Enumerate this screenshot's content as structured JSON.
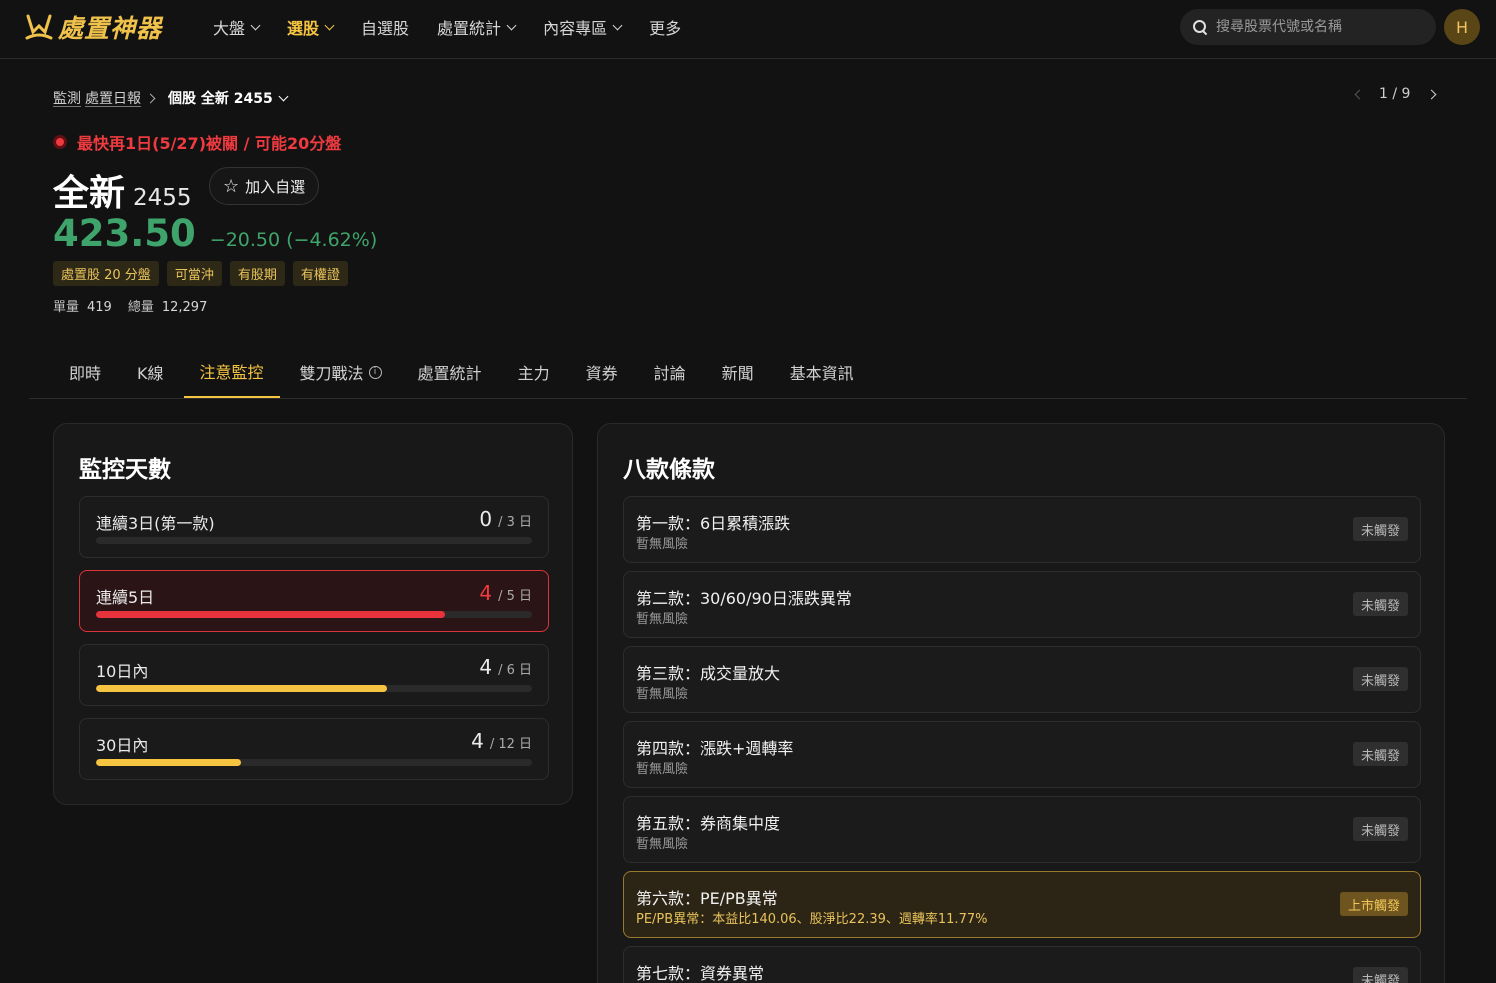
{
  "app": {
    "logo_text": "處置神器",
    "avatar_initial": "H"
  },
  "nav": {
    "items": [
      {
        "label": "大盤",
        "dropdown": true,
        "active": false
      },
      {
        "label": "選股",
        "dropdown": true,
        "active": true
      },
      {
        "label": "自選股",
        "dropdown": false,
        "active": false
      },
      {
        "label": "處置統計",
        "dropdown": true,
        "active": false
      },
      {
        "label": "內容專區",
        "dropdown": true,
        "active": false
      },
      {
        "label": "更多",
        "dropdown": false,
        "active": false
      }
    ],
    "search_placeholder": "搜尋股票代號或名稱"
  },
  "breadcrumb": {
    "link1": "監測",
    "link2": "處置日報",
    "current": "個股 全新 2455"
  },
  "pager": {
    "text": "1 / 9"
  },
  "alert": {
    "text": "最快再1日(5/27)被關 / 可能20分盤"
  },
  "stock": {
    "name": "全新",
    "code": "2455",
    "watch_label": "加入自選",
    "price": "423.50",
    "change": "−20.50 (−4.62%)",
    "tags": [
      "處置股 20 分盤",
      "可當沖",
      "有股期",
      "有權證"
    ],
    "single_volume_label": "單量",
    "single_volume": "419",
    "total_volume_label": "總量",
    "total_volume": "12,297"
  },
  "tabs": [
    {
      "label": "即時",
      "active": false
    },
    {
      "label": "K線",
      "active": false
    },
    {
      "label": "注意監控",
      "active": true
    },
    {
      "label": "雙刀戰法",
      "active": false,
      "info": true
    },
    {
      "label": "處置統計",
      "active": false
    },
    {
      "label": "主力",
      "active": false
    },
    {
      "label": "資券",
      "active": false
    },
    {
      "label": "討論",
      "active": false
    },
    {
      "label": "新聞",
      "active": false
    },
    {
      "label": "基本資訊",
      "active": false
    }
  ],
  "monitor": {
    "title": "監控天數",
    "items": [
      {
        "label": "連續3日(第一款)",
        "value": "0",
        "total": "/ 3 日",
        "progress": 0.0,
        "color": "#f5c542",
        "alert": false
      },
      {
        "label": "連續5日",
        "value": "4",
        "total": "/ 5 日",
        "progress": 0.8,
        "color": "#e8323c",
        "alert": true
      },
      {
        "label": "10日內",
        "value": "4",
        "total": "/ 6 日",
        "progress": 0.6667,
        "color": "#f5c542",
        "alert": false
      },
      {
        "label": "30日內",
        "value": "4",
        "total": "/ 12 日",
        "progress": 0.3333,
        "color": "#f5c542",
        "alert": false
      }
    ]
  },
  "rules": {
    "title": "八款條款",
    "items": [
      {
        "title": "第一款：6日累積漲跌",
        "sub": "暫無風險",
        "badge": "未觸發",
        "hit": false
      },
      {
        "title": "第二款：30/60/90日漲跌異常",
        "sub": "暫無風險",
        "badge": "未觸發",
        "hit": false
      },
      {
        "title": "第三款：成交量放大",
        "sub": "暫無風險",
        "badge": "未觸發",
        "hit": false
      },
      {
        "title": "第四款：漲跌+週轉率",
        "sub": "暫無風險",
        "badge": "未觸發",
        "hit": false
      },
      {
        "title": "第五款：券商集中度",
        "sub": "暫無風險",
        "badge": "未觸發",
        "hit": false
      },
      {
        "title": "第六款：PE/PB異常",
        "sub": "PE/PB異常：本益比140.06、股淨比22.39、週轉率11.77%",
        "badge": "上市觸發",
        "hit": true
      },
      {
        "title": "第七款：資券異常",
        "sub": "",
        "badge": "未觸發",
        "hit": false
      }
    ]
  },
  "colors": {
    "accent": "#f5c542",
    "down": "#3fa46b",
    "danger": "#ef3a3f"
  }
}
